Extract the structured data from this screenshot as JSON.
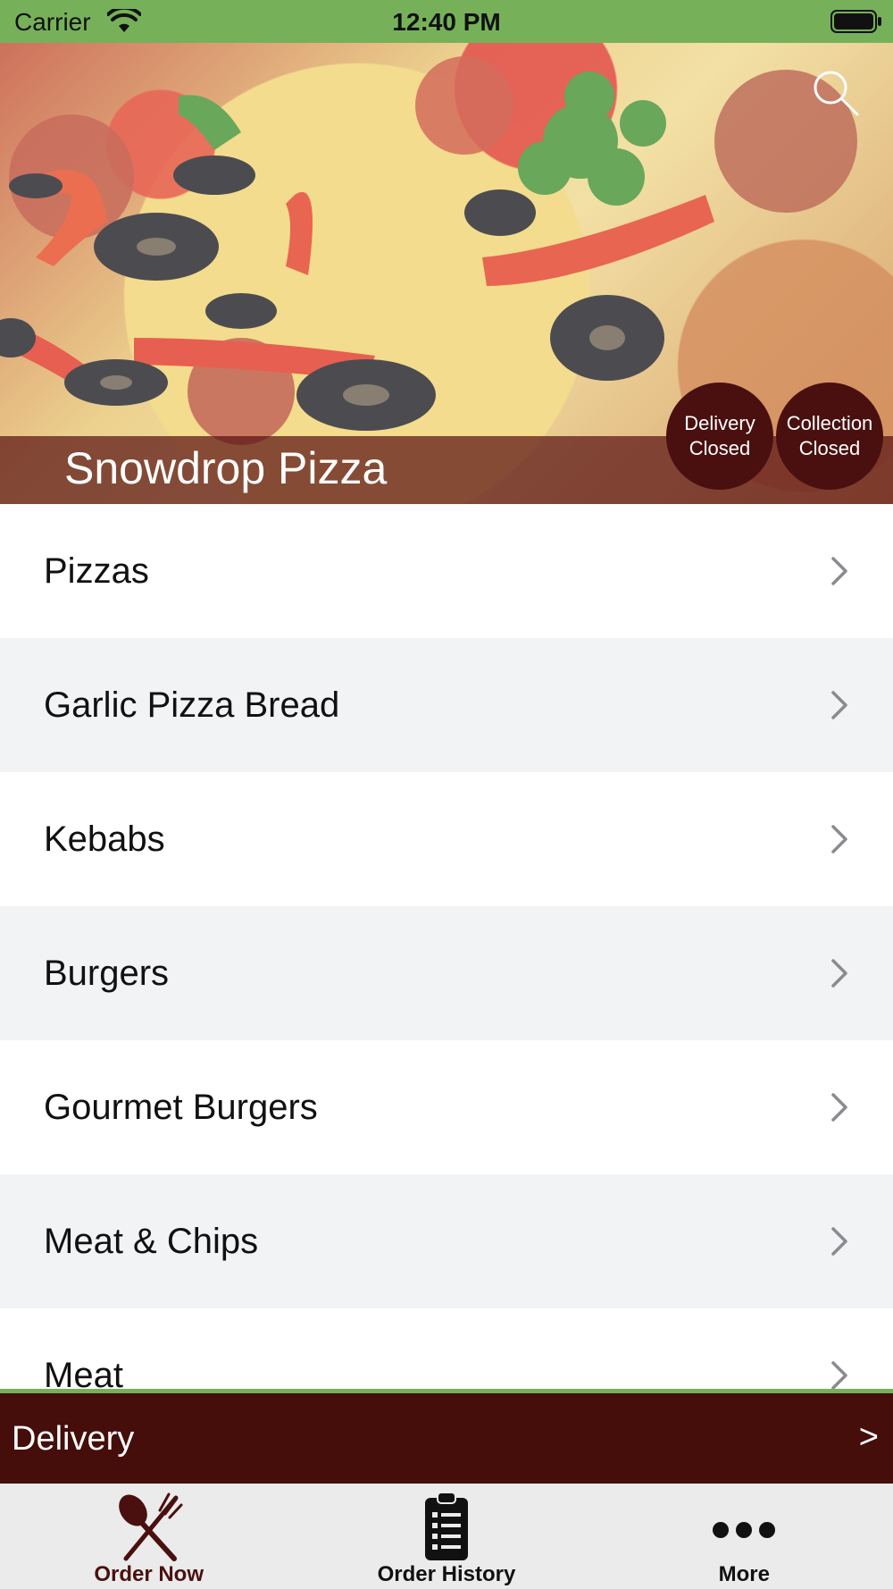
{
  "status_bar": {
    "carrier": "Carrier",
    "time": "12:40 PM"
  },
  "restaurant": {
    "name": "Snowdrop Pizza"
  },
  "badges": {
    "delivery": "Delivery Closed",
    "collection": "Collection Closed"
  },
  "categories": [
    {
      "label": "Pizzas"
    },
    {
      "label": "Garlic Pizza Bread"
    },
    {
      "label": "Kebabs"
    },
    {
      "label": "Burgers"
    },
    {
      "label": "Gourmet Burgers"
    },
    {
      "label": "Meat & Chips"
    },
    {
      "label": "Meat"
    }
  ],
  "delivery_bar": {
    "label": "Delivery",
    "arrow": ">"
  },
  "tab_bar": {
    "order_now": "Order Now",
    "order_history": "Order History",
    "more": "More"
  },
  "colors": {
    "status_green": "#76b15a",
    "brand_maroon": "#450e0b",
    "badge_maroon": "#4a1010",
    "row_alt": "#f2f3f5"
  },
  "icons": {
    "search": "search-icon",
    "chevron": "chevron-right-icon",
    "order_now": "fork-knife-icon",
    "order_history": "clipboard-list-icon",
    "more": "ellipsis-icon"
  }
}
